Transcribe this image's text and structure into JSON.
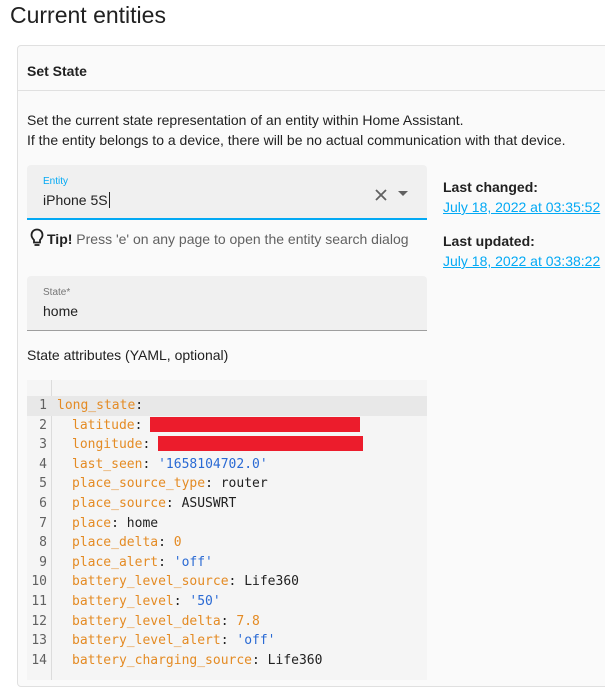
{
  "page": {
    "title": "Current entities"
  },
  "card": {
    "title": "Set State",
    "description": [
      "Set the current state representation of an entity within Home Assistant.",
      "If the entity belongs to a device, there will be no actual communication with that device."
    ]
  },
  "entity_field": {
    "label": "Entity",
    "value": "iPhone 5S"
  },
  "tip": {
    "label": "Tip!",
    "text": "Press 'e' on any page to open the entity search dialog"
  },
  "state_field": {
    "label": "State*",
    "value": "home"
  },
  "attributes_label": "State attributes (YAML, optional)",
  "last_changed": {
    "label": "Last changed:",
    "value": "July 18, 2022 at 03:35:52"
  },
  "last_updated": {
    "label": "Last updated:",
    "value": "July 18, 2022 at 03:38:22"
  },
  "yaml_lines": [
    {
      "num": "1",
      "key": "long_state",
      "sep": ":",
      "value": "",
      "type": "none"
    },
    {
      "num": "2",
      "key": "latitude",
      "sep": ": ",
      "value": "",
      "type": "redacted"
    },
    {
      "num": "3",
      "key": "longitude",
      "sep": ": ",
      "value": "",
      "type": "redacted"
    },
    {
      "num": "4",
      "key": "last_seen",
      "sep": ": ",
      "value": "'1658104702.0'",
      "type": "string"
    },
    {
      "num": "5",
      "key": "place_source_type",
      "sep": ": ",
      "value": "router",
      "type": "plain"
    },
    {
      "num": "6",
      "key": "place_source",
      "sep": ": ",
      "value": "ASUSWRT",
      "type": "plain"
    },
    {
      "num": "7",
      "key": "place",
      "sep": ": ",
      "value": "home",
      "type": "plain"
    },
    {
      "num": "8",
      "key": "place_delta",
      "sep": ": ",
      "value": "0",
      "type": "number"
    },
    {
      "num": "9",
      "key": "place_alert",
      "sep": ": ",
      "value": "'off'",
      "type": "string"
    },
    {
      "num": "10",
      "key": "battery_level_source",
      "sep": ": ",
      "value": "Life360",
      "type": "plain"
    },
    {
      "num": "11",
      "key": "battery_level",
      "sep": ": ",
      "value": "'50'",
      "type": "string"
    },
    {
      "num": "12",
      "key": "battery_level_delta",
      "sep": ": ",
      "value": "7.8",
      "type": "number"
    },
    {
      "num": "13",
      "key": "battery_level_alert",
      "sep": ": ",
      "value": "'off'",
      "type": "string"
    },
    {
      "num": "14",
      "key": "battery_charging_source",
      "sep": ": ",
      "value": "Life360",
      "type": "plain"
    }
  ],
  "colors": {
    "accent": "#03a9f4",
    "yaml_key": "#e48b24",
    "yaml_string": "#2a6ad4",
    "redaction": "#ec1c2c"
  },
  "icons": {
    "clear": "close-icon",
    "dropdown": "chevron-down-icon",
    "tip": "lightbulb-icon"
  }
}
